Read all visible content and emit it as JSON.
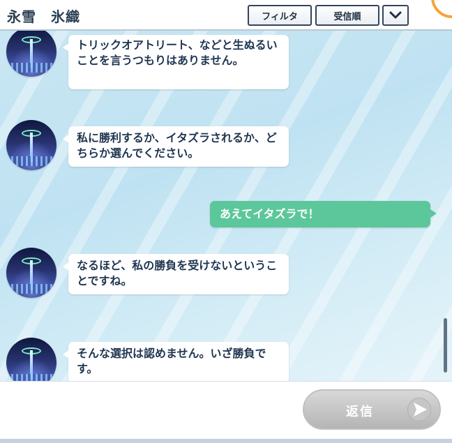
{
  "header": {
    "title": "永雪　氷織",
    "filter_label": "フィルタ",
    "order_label": "受信順",
    "chevron_icon": "chevron-down-icon"
  },
  "messages": [
    {
      "sender": "other",
      "text": "トリックオアトリート、などと生ぬるいことを言うつもりはありません。"
    },
    {
      "sender": "other",
      "text": "私に勝利するか、イタズラされるか、どちらか選んでください。"
    },
    {
      "sender": "me",
      "text": "あえてイタズラで！"
    },
    {
      "sender": "other",
      "text": "なるほど、私の勝負を受けないということですね。"
    },
    {
      "sender": "other",
      "text": "そんな選択は認めません。いざ勝負です。"
    }
  ],
  "footer": {
    "reply_label": "返信",
    "send_icon": "send-icon"
  },
  "colors": {
    "accent_green": "#5cc79a",
    "header_text": "#2b3f52",
    "bubble_text": "#1f3550",
    "corner_accent": "#f4a43c"
  }
}
